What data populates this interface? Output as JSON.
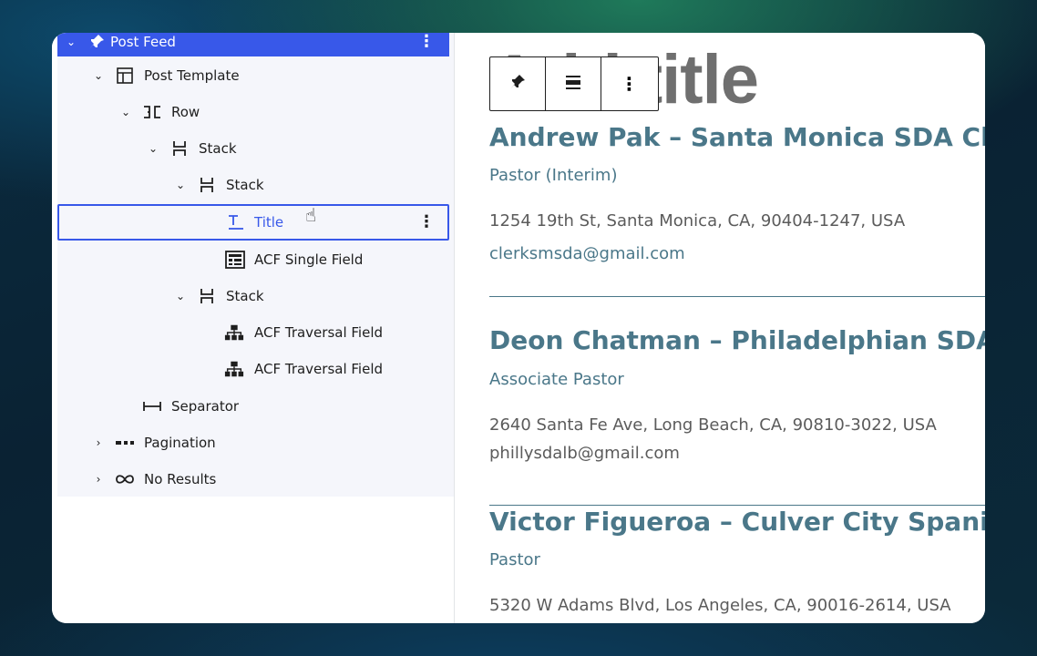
{
  "list_view": {
    "items": [
      {
        "label": "Post Feed",
        "icon": "pin-icon",
        "expanded": true,
        "selected": true
      },
      {
        "label": "Post Template",
        "icon": "template-icon",
        "expanded": true
      },
      {
        "label": "Row",
        "icon": "row-icon",
        "expanded": true
      },
      {
        "label": "Stack",
        "icon": "stack-icon",
        "expanded": true
      },
      {
        "label": "Stack",
        "icon": "stack-icon",
        "expanded": true
      },
      {
        "label": "Title",
        "icon": "title-icon",
        "hovered": true
      },
      {
        "label": "ACF Single Field",
        "icon": "acf-field-icon"
      },
      {
        "label": "Stack",
        "icon": "stack-icon",
        "expanded": true
      },
      {
        "label": "ACF Traversal Field",
        "icon": "hierarchy-icon"
      },
      {
        "label": "ACF Traversal Field",
        "icon": "hierarchy-icon"
      },
      {
        "label": "Separator",
        "icon": "separator-icon"
      },
      {
        "label": "Pagination",
        "icon": "pagination-icon",
        "expanded": false
      },
      {
        "label": "No Results",
        "icon": "loop-icon",
        "expanded": false
      }
    ]
  },
  "editor": {
    "page_title_placeholder": "Add title",
    "toolbar": {
      "pin": "pin-icon",
      "align": "align-icon",
      "more": "more-vertical-icon"
    },
    "entries": [
      {
        "name": "Andrew Pak – Santa Monica SDA Chu",
        "role": "Pastor (Interim)",
        "address": "1254 19th St, Santa Monica, CA, 90404-1247, USA",
        "email": "clerksmsda@gmail.com"
      },
      {
        "name": "Deon Chatman – Philadelphian SDA C",
        "role": "Associate Pastor",
        "address": "2640 Santa Fe Ave, Long Beach, CA, 90810-3022, USA",
        "email": "phillysdalb@gmail.com"
      },
      {
        "name": "Victor Figueroa – Culver City Spanish",
        "role": "Pastor",
        "address": "5320 W Adams Blvd, Los Angeles, CA, 90016-2614, USA",
        "email": ""
      }
    ]
  },
  "colors": {
    "accent": "#3858e9",
    "entry_color": "#4a7789"
  }
}
